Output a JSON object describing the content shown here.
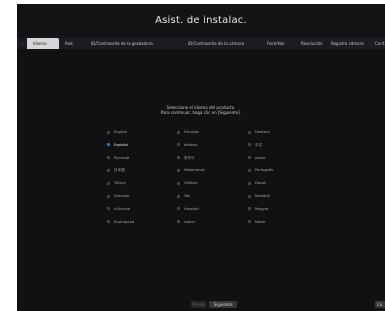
{
  "window": {
    "title": "Asist. de instalac."
  },
  "tabs": [
    {
      "label": "Idioma"
    },
    {
      "label": "Red"
    },
    {
      "label": "ID/Contraseña de la grabadora"
    },
    {
      "label": "ID/Contraseña de la cámara"
    },
    {
      "label": "Fech/Hor"
    },
    {
      "label": "Resolución"
    },
    {
      "label": "Registro cámara"
    },
    {
      "label": "Conf. ca"
    }
  ],
  "instruction": {
    "line1": "Seleccione el idioma del producto.",
    "line2": "Para continuar, haga clic en [Siguiente]."
  },
  "languages": {
    "col1": [
      "English",
      "Español",
      "Русский",
      "日本語",
      "Türkçe",
      "Svenska",
      "ελληνικά",
      "Български"
    ],
    "col2": [
      "Français",
      "Italiano",
      "한국어",
      "Nederlands",
      "Čeština",
      "Ýas",
      "Hrvatski",
      "suomi"
    ],
    "col3": [
      "Deutsch",
      "中文",
      "polski",
      "Português",
      "Dansk",
      "Română",
      "Magyar",
      "Norsk"
    ],
    "selected": "Español"
  },
  "buttons": {
    "prev": "Previo",
    "next": "Siguiente",
    "cancel": "Ca"
  },
  "colors": {
    "background": "#111113",
    "accent": "#3a7bd5"
  }
}
